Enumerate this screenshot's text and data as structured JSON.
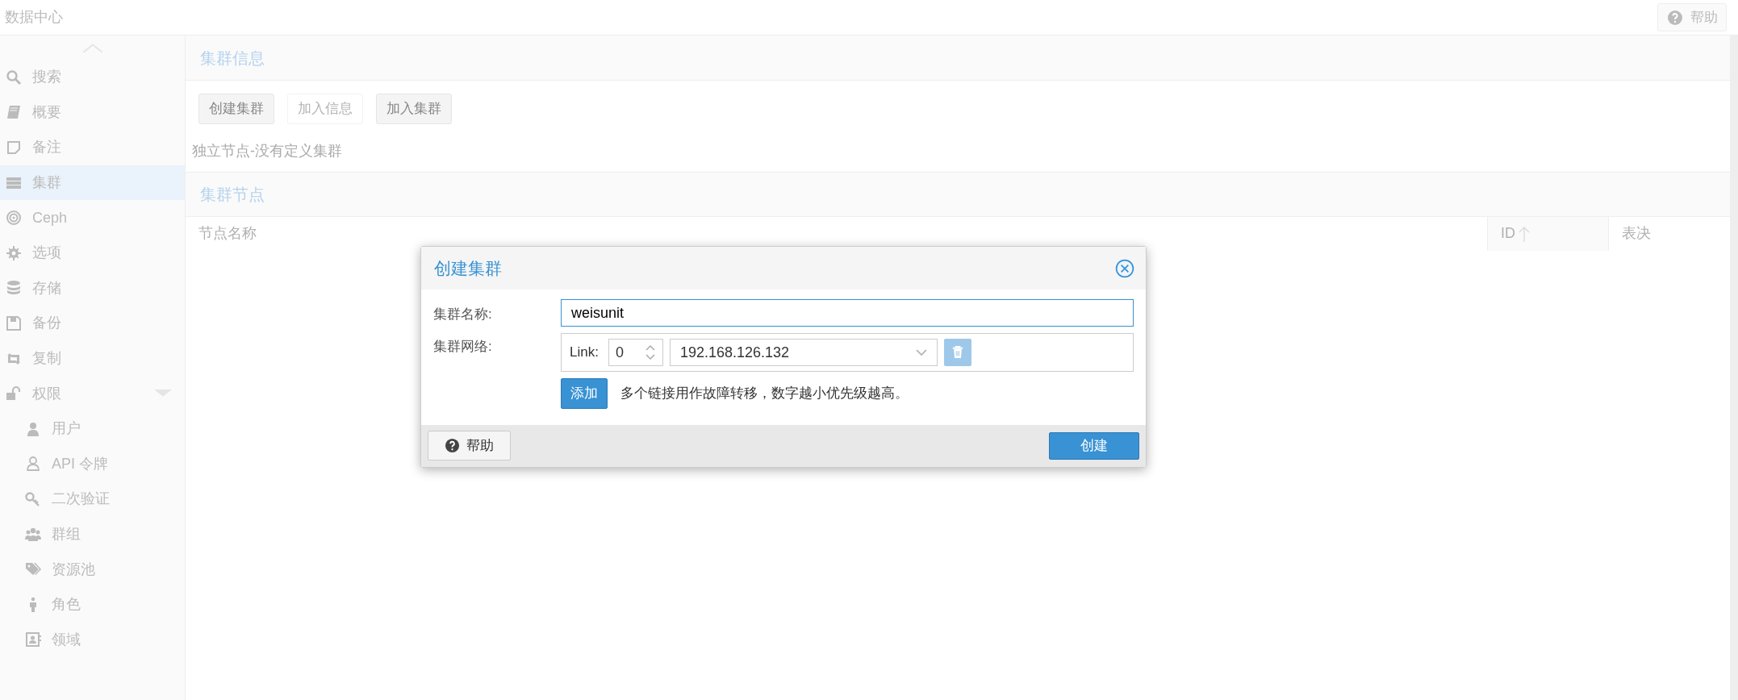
{
  "top_bar": {
    "title": "数据中心",
    "help_button": "帮助"
  },
  "sidebar": {
    "items": [
      {
        "label": "搜索",
        "selected": false
      },
      {
        "label": "概要",
        "selected": false
      },
      {
        "label": "备注",
        "selected": false
      },
      {
        "label": "集群",
        "selected": true
      },
      {
        "label": "Ceph",
        "selected": false
      },
      {
        "label": "选项",
        "selected": false
      },
      {
        "label": "存储",
        "selected": false
      },
      {
        "label": "备份",
        "selected": false
      },
      {
        "label": "复制",
        "selected": false
      },
      {
        "label": "权限",
        "selected": false,
        "expanded": true,
        "children": [
          {
            "label": "用户",
            "selected": false
          },
          {
            "label": "API 令牌",
            "selected": false
          },
          {
            "label": "二次验证",
            "selected": false
          },
          {
            "label": "群组",
            "selected": false
          },
          {
            "label": "资源池",
            "selected": false
          },
          {
            "label": "角色",
            "selected": false
          },
          {
            "label": "领域",
            "selected": false
          }
        ]
      }
    ]
  },
  "cluster_info": {
    "title": "集群信息",
    "buttons": [
      {
        "label": "创建集群",
        "disabled": false
      },
      {
        "label": "加入信息",
        "disabled": true
      },
      {
        "label": "加入集群",
        "disabled": false
      }
    ],
    "status": "独立节点-没有定义集群"
  },
  "cluster_nodes": {
    "title": "集群节点",
    "columns": [
      {
        "label": "节点名称",
        "sorted": false
      },
      {
        "label": "ID",
        "sorted": true
      },
      {
        "label": "表决",
        "sorted": false
      }
    ]
  },
  "dialog": {
    "title": "创建集群",
    "fields": [
      {
        "kind": "text",
        "label": "集群名称:",
        "value": "weisunit"
      },
      {
        "kind": "links",
        "label": "集群网络:",
        "links": [
          {
            "label": "Link:",
            "number": "0",
            "address": "192.168.126.132"
          }
        ],
        "add_button": "添加",
        "hint": "多个链接用作故障转移，数字越小优先级越高。"
      }
    ],
    "help_button": "帮助",
    "submit_button": "创建"
  }
}
